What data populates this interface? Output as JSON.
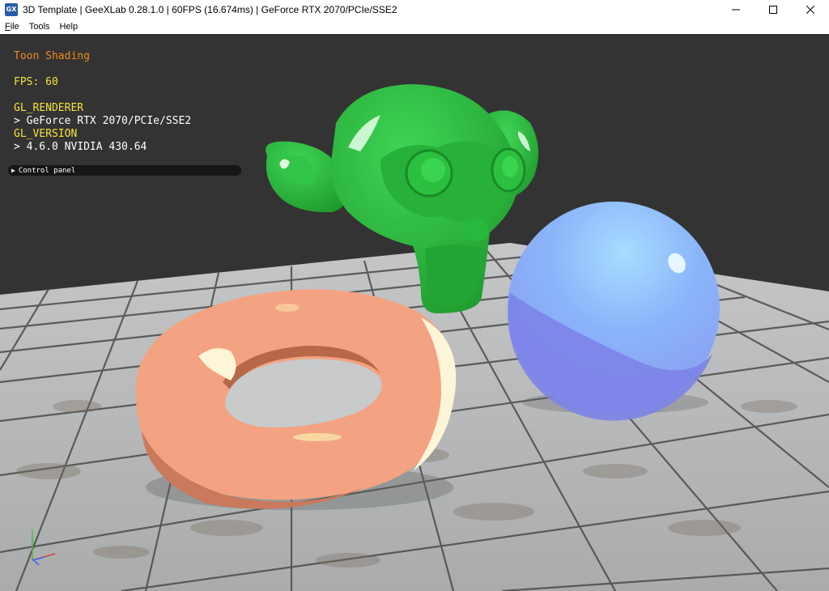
{
  "window": {
    "title": "3D Template | GeeXLab 0.28.1.0 | 60FPS (16.674ms) | GeForce RTX 2070/PCIe/SSE2",
    "icon": "geexlab-app-icon",
    "controls": [
      "minimize-icon",
      "maximize-icon",
      "close-icon"
    ]
  },
  "menu": {
    "items": [
      {
        "mnemonic": "F",
        "rest": "ile"
      },
      {
        "mnemonic": "",
        "rest": "Tools"
      },
      {
        "mnemonic": "",
        "rest": "Help"
      }
    ]
  },
  "overlay": {
    "title": "Toon Shading",
    "fps": "FPS: 60",
    "renderer_label": "GL_RENDERER",
    "renderer_value": "> GeForce RTX 2070/PCIe/SSE2",
    "version_label": "GL_VERSION",
    "version_value": "> 4.6.0 NVIDIA 430.64"
  },
  "control_panel": {
    "label": "Control panel",
    "arrow_icon": "triangle-right-icon"
  },
  "colors": {
    "viewport_bg": "#333333",
    "title_orange": "#f28a1e",
    "label_yellow": "#f5e23a",
    "torus": "#f0a080",
    "sphere": "#8aa8f8",
    "monkey": "#2cc040",
    "floor": "#b8babb"
  },
  "scene": {
    "objects": [
      "suzanne-monkey-head",
      "torus",
      "sphere",
      "tiled-floor",
      "axis-gizmo"
    ]
  }
}
